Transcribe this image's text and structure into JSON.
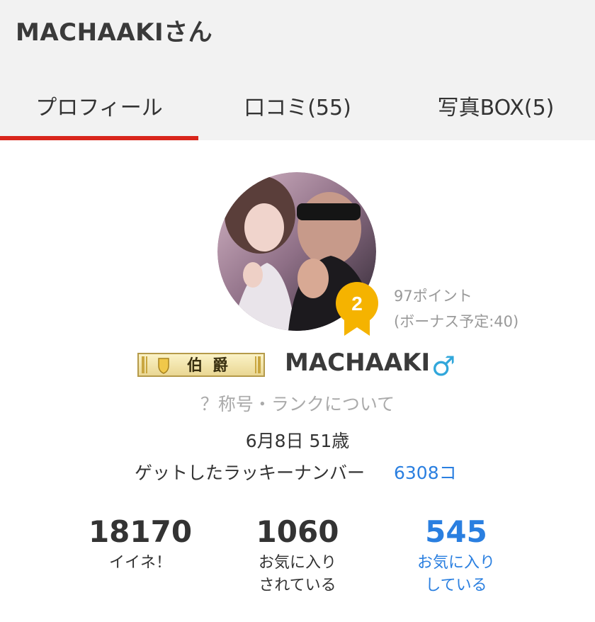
{
  "header": {
    "title": "MACHAAKIさん",
    "tabs": [
      {
        "label": "プロフィール",
        "active": true
      },
      {
        "label": "口コミ(55)",
        "active": false
      },
      {
        "label": "写真BOX(5)",
        "active": false
      }
    ],
    "indicator_color": "#d9261c"
  },
  "profile": {
    "rank_number": "2",
    "points": "97ポイント",
    "bonus": "(ボーナス予定:40)",
    "title_badge": "伯爵",
    "username": "MACHAAKI",
    "gender_symbol": "♂",
    "rank_link": "？称号・ランクについて",
    "birthday_age": "6月8日 51歳",
    "lucky_label": "ゲットしたラッキーナンバー",
    "lucky_count": "6308コ"
  },
  "stats": [
    {
      "value": "18170",
      "label_line1": "イイネ！",
      "label_line2": ""
    },
    {
      "value": "1060",
      "label_line1": "お気に入り",
      "label_line2": "されている"
    },
    {
      "value": "545",
      "label_line1": "お気に入り",
      "label_line2": "している"
    }
  ],
  "colors": {
    "accent_red": "#d9261c",
    "link_blue": "#2a7fe0",
    "medal_gold": "#f5b300",
    "gender_blue": "#31a7db"
  }
}
